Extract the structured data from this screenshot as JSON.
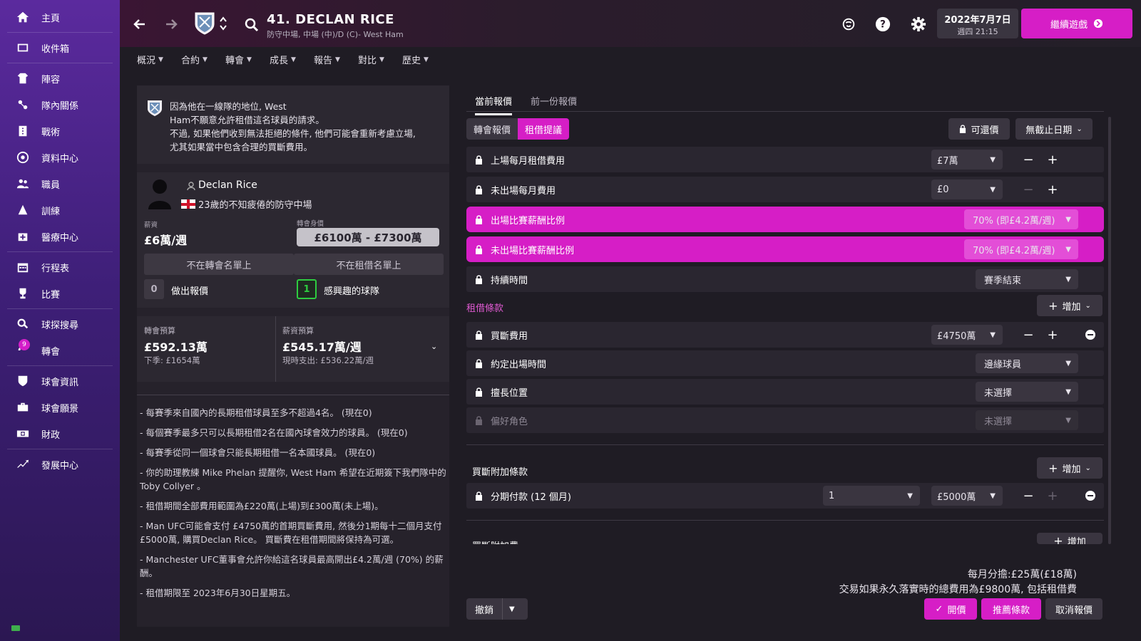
{
  "sidebar": {
    "items": [
      {
        "label": "主頁",
        "icon": "home-icon"
      },
      {
        "label": "收件箱",
        "icon": "inbox-icon"
      },
      {
        "label": "陣容",
        "icon": "squad-icon"
      },
      {
        "label": "隊內關係",
        "icon": "dynamics-icon"
      },
      {
        "label": "戰術",
        "icon": "tactics-icon"
      },
      {
        "label": "資料中心",
        "icon": "data-hub-icon"
      },
      {
        "label": "職員",
        "icon": "staff-icon"
      },
      {
        "label": "訓練",
        "icon": "training-icon"
      },
      {
        "label": "醫療中心",
        "icon": "medical-icon"
      },
      {
        "label": "行程表",
        "icon": "calendar-icon"
      },
      {
        "label": "比賽",
        "icon": "trophy-icon"
      },
      {
        "label": "球探搜尋",
        "icon": "scouting-icon"
      },
      {
        "label": "轉會",
        "icon": "transfers-icon",
        "badge": "9"
      },
      {
        "label": "球會資訊",
        "icon": "club-info-icon"
      },
      {
        "label": "球會願景",
        "icon": "club-vision-icon"
      },
      {
        "label": "財政",
        "icon": "finances-icon"
      },
      {
        "label": "發展中心",
        "icon": "development-icon"
      }
    ]
  },
  "header": {
    "title": "41. DECLAN RICE",
    "subtitle": "防守中場, 中場 (中)/D (C)- West Ham",
    "date": "2022年7月7日",
    "weekday_time": "週四 21:15",
    "continue_label": "繼續遊戲"
  },
  "menu_tabs": [
    "概況",
    "合約",
    "轉會",
    "成長",
    "報告",
    "對比",
    "歷史"
  ],
  "notice": {
    "text_line1": "因為他在一線隊的地位, West",
    "text_line2": "Ham不願意允許租借這名球員的請求。",
    "text_line3": "不過, 如果他們收到無法拒絕的條件, 他們可能會重新考慮立場,",
    "text_line4": "尤其如果當中包含合理的買斷費用。"
  },
  "player_card": {
    "name": "Declan Rice",
    "description": "23歲的不知疲倦的防守中場",
    "wage_label": "薪資",
    "wage_value": "£6萬/週",
    "value_label": "轉會身價",
    "value_range": "£6100萬 - £7300萬",
    "not_transfer_listed": "不在轉會名單上",
    "not_loan_listed": "不在租借名單上",
    "offers_count": "0",
    "offers_label": "做出報價",
    "interested_count": "1",
    "interested_label": "感興趣的球隊"
  },
  "budget": {
    "transfer_label": "轉會預算",
    "transfer_value": "£592.13萬",
    "transfer_sub": "下季: £1654萬",
    "wage_label": "薪資預算",
    "wage_value": "£545.17萬/週",
    "wage_sub": "現時支出: £536.22萬/週"
  },
  "rules": [
    "- 每賽季來自國內的長期租借球員至多不超過4名。 (現在0)",
    "- 每個賽季最多只可以長期租借2名在國內球會效力的球員。 (現在0)",
    "- 每賽季從同一個球會只能長期租借一名本國球員。 (現在0)",
    "- 你的助理教練 Mike Phelan 提醒你, West Ham 希望在近期簽下我們隊中的 Toby Collyer 。",
    "- 租借期間全部費用範圍為£220萬(上場)到£300萬(未上場)。",
    "- Man UFC可能會支付 £4750萬的首期買斷費用, 然後分1期每十二個月支付£5000萬, 購買Declan Rice。 買斷費在租借期間將保持為可選。",
    "- Manchester UFC董事會允許你給這名球員最高開出£4.2萬/週 (70%) 的薪酬。",
    "- 租借期限至 2023年6月30日星期五。"
  ],
  "offer": {
    "tab_current": "當前報價",
    "tab_previous": "前一份報價",
    "seg_transfer": "轉會報價",
    "seg_loan": "租借提議",
    "negotiable_label": "可還價",
    "deadline_label": "無截止日期",
    "rows": {
      "monthly_fee_played": {
        "label": "上場每月租借費用",
        "value": "£7萬"
      },
      "monthly_fee_unplayed": {
        "label": "未出場每月費用",
        "value": "£0"
      },
      "wage_pct_played": {
        "label": "出場比賽薪酬比例",
        "value": "70% (即£4.2萬/週)"
      },
      "wage_pct_unplayed": {
        "label": "未出場比賽薪酬比例",
        "value": "70% (即£4.2萬/週)"
      },
      "duration": {
        "label": "持續時間",
        "value": "賽季結束"
      }
    },
    "loan_terms_label": "租借條款",
    "add_label": "增加",
    "terms": {
      "buyout_fee": {
        "label": "買斷費用",
        "value": "£4750萬"
      },
      "playing_time": {
        "label": "約定出場時間",
        "value": "邊緣球員"
      },
      "position": {
        "label": "擅長位置",
        "value": "未選擇"
      },
      "role": {
        "label": "偏好角色",
        "value": "未選擇"
      }
    },
    "buyout_clauses_label": "買斷附加條款",
    "installments": {
      "label": "分期付款 (12 個月)",
      "count": "1",
      "value": "£5000萬"
    },
    "buyout_extras_label": "買斷附加費",
    "monthly_share": "每月分擔:£25萬(£18萬)",
    "total_fee_note": "交易如果永久落實時的總費用為£9800萬, 包括租借費",
    "undo_label": "撤銷",
    "offer_label": "開價",
    "suggest_label": "推薦條款",
    "cancel_label": "取消報價"
  },
  "colors": {
    "accent": "#d61ec6",
    "sidebar_top": "#5b2a9e",
    "sidebar_bottom": "#2b1752",
    "background": "#1f1c24",
    "positive": "#2ecc40",
    "section_label": "#e05ad2"
  }
}
